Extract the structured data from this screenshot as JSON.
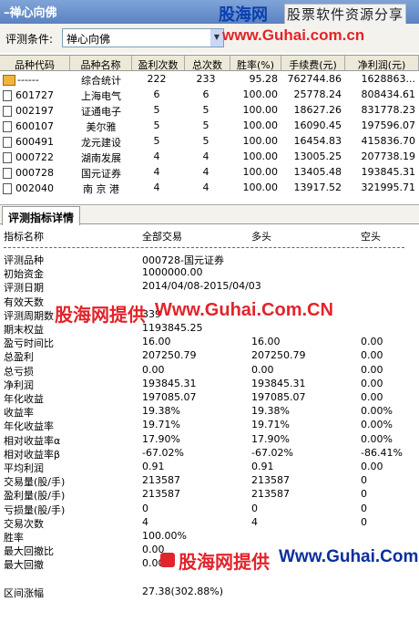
{
  "window": {
    "title": "–禅心向佛"
  },
  "watermark": {
    "logo": "股海网",
    "subtitle": "股票软件资源分享",
    "url_top": "www.Guhai.com.cn",
    "mid_text": "股海网提供",
    "mid_url": "Www.Guhai.Com.CN",
    "bottom_text": "股海网提供",
    "bottom_url": "Www.Guhai.Com.CN"
  },
  "condition": {
    "label": "评测条件:",
    "value": "禅心向佛"
  },
  "grid": {
    "headers": [
      "品种代码",
      "品种名称",
      "盈利次数",
      "总次数",
      "胜率(%)",
      "手续费(元)",
      "净利润(元)"
    ],
    "rows": [
      [
        "------",
        "综合统计",
        "222",
        "233",
        "95.28",
        "762744.86",
        "1628863..."
      ],
      [
        "601727",
        "上海电气",
        "6",
        "6",
        "100.00",
        "25778.24",
        "808434.61"
      ],
      [
        "002197",
        "证通电子",
        "5",
        "5",
        "100.00",
        "18627.26",
        "831778.23"
      ],
      [
        "600107",
        "美尔雅",
        "5",
        "5",
        "100.00",
        "16090.45",
        "197596.07"
      ],
      [
        "600491",
        "龙元建设",
        "5",
        "5",
        "100.00",
        "16454.83",
        "415836.70"
      ],
      [
        "000722",
        "湖南发展",
        "4",
        "4",
        "100.00",
        "13005.25",
        "207738.19"
      ],
      [
        "000728",
        "国元证券",
        "4",
        "4",
        "100.00",
        "13405.48",
        "193845.31"
      ],
      [
        "002040",
        "南 京 港",
        "4",
        "4",
        "100.00",
        "13917.52",
        "321995.71"
      ]
    ]
  },
  "tab": {
    "label": "评测指标详情"
  },
  "details": {
    "headers": [
      "指标名称",
      "全部交易",
      "多头",
      "空头"
    ],
    "rows": [
      [
        "评测品种",
        "000728-国元证券",
        "",
        ""
      ],
      [
        "初始资金",
        "1000000.00",
        "",
        ""
      ],
      [
        "评测日期",
        "2014/04/08-2015/04/03",
        "",
        ""
      ],
      [
        "有效天数",
        "",
        "",
        ""
      ],
      [
        "评测周期数",
        "339",
        "",
        ""
      ],
      [
        "期末权益",
        "1193845.25",
        "",
        ""
      ],
      [
        "盈亏时间比",
        "16.00",
        "16.00",
        "0.00"
      ],
      [
        "总盈利",
        "207250.79",
        "207250.79",
        "0.00"
      ],
      [
        "总亏损",
        "0.00",
        "0.00",
        "0.00"
      ],
      [
        "净利润",
        "193845.31",
        "193845.31",
        "0.00"
      ],
      [
        "年化收益",
        "197085.07",
        "197085.07",
        "0.00"
      ],
      [
        "收益率",
        "19.38%",
        "19.38%",
        "0.00%"
      ],
      [
        "年化收益率",
        "19.71%",
        "19.71%",
        "0.00%"
      ],
      [
        "相对收益率α",
        "17.90%",
        "17.90%",
        "0.00%"
      ],
      [
        "相对收益率β",
        "-67.02%",
        "-67.02%",
        "-86.41%"
      ],
      [
        "平均利润",
        "0.91",
        "0.91",
        "0.00"
      ],
      [
        "交易量(股/手)",
        "213587",
        "213587",
        "0"
      ],
      [
        "盈利量(股/手)",
        "213587",
        "213587",
        "0"
      ],
      [
        "亏损量(股/手)",
        "0",
        "0",
        "0"
      ],
      [
        "交易次数",
        "4",
        "4",
        "0"
      ],
      [
        "胜率",
        "100.00%",
        "",
        ""
      ],
      [
        "最大回撤比",
        "0.00",
        "",
        ""
      ],
      [
        "最大回撤",
        "0.00",
        "",
        ""
      ],
      [
        "",
        "",
        "",
        ""
      ],
      [
        "区间涨幅",
        "27.38(302.88%)",
        "",
        ""
      ]
    ]
  }
}
